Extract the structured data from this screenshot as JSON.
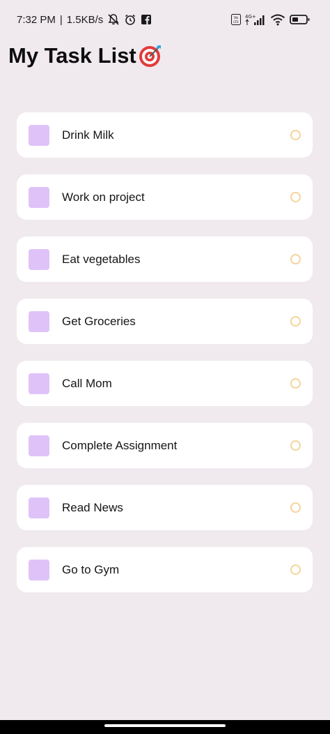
{
  "status_bar": {
    "time": "7:32 PM",
    "separator": "|",
    "speed": "1.5KB/s",
    "network_type": "4G+",
    "lte": "LTE"
  },
  "header": {
    "title": "My Task List"
  },
  "tasks": [
    {
      "label": "Drink Milk"
    },
    {
      "label": "Work on project"
    },
    {
      "label": "Eat vegetables"
    },
    {
      "label": "Get Groceries"
    },
    {
      "label": "Call Mom"
    },
    {
      "label": "Complete Assignment"
    },
    {
      "label": "Read News"
    },
    {
      "label": "Go to Gym"
    }
  ],
  "colors": {
    "background": "#f0eaef",
    "card": "#ffffff",
    "checkbox": "#dfc3f8",
    "status_ring": "#f5d39b"
  }
}
